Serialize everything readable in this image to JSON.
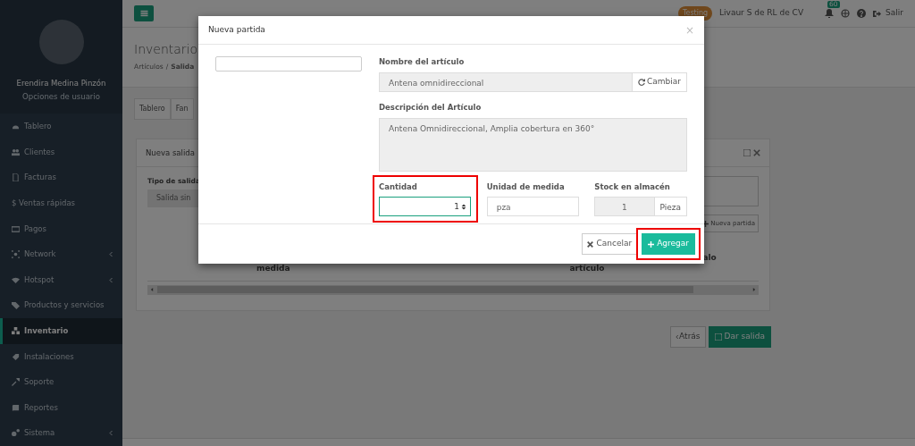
{
  "sidebar": {
    "user_name": "Erendira Medina Pinzón",
    "user_options": "Opciones de usuario",
    "items": [
      {
        "label": "Tablero",
        "selected": false,
        "has_submenu": false
      },
      {
        "label": "Clientes",
        "selected": false,
        "has_submenu": false
      },
      {
        "label": "Facturas",
        "selected": false,
        "has_submenu": false
      },
      {
        "label": "$ Ventas rápidas",
        "selected": false,
        "has_submenu": false
      },
      {
        "label": "Pagos",
        "selected": false,
        "has_submenu": false
      },
      {
        "label": "Network",
        "selected": false,
        "has_submenu": true
      },
      {
        "label": "Hotspot",
        "selected": false,
        "has_submenu": true
      },
      {
        "label": "Productos y servicios",
        "selected": false,
        "has_submenu": false
      },
      {
        "label": "Inventario",
        "selected": true,
        "has_submenu": false
      },
      {
        "label": "Instalaciones",
        "selected": false,
        "has_submenu": false
      },
      {
        "label": "Soporte",
        "selected": false,
        "has_submenu": false
      },
      {
        "label": "Reportes",
        "selected": false,
        "has_submenu": false
      },
      {
        "label": "Sistema",
        "selected": false,
        "has_submenu": true
      }
    ]
  },
  "topbar": {
    "env_badge": "Testing",
    "company": "Livaur S de RL de CV",
    "notifications": "60",
    "logout": "Salir"
  },
  "page": {
    "title": "Inventario",
    "breadcrumb": [
      "Artículos",
      "Salida"
    ],
    "breadcrumb_separator": "/",
    "tabs": [
      "Tablero",
      "Fan"
    ],
    "card": {
      "title": "Nueva salida",
      "type_label": "Tipo de salida",
      "type_value": "Salida sin",
      "new_item_button": "Nueva partida",
      "columns": [
        "medida",
        "artículo",
        "alo"
      ]
    },
    "back_button": "Atrás",
    "submit_button": "Dar salida"
  },
  "modal": {
    "title": "Nueva partida",
    "close": "×",
    "name_label": "Nombre del artículo",
    "name_value": "Antena omnidireccional",
    "change_button": "Cambiar",
    "description_label": "Descripción del Artículo",
    "description_value": "Antena Omnidireccional, Amplia cobertura en 360°",
    "quantity": {
      "label": "Cantidad",
      "value": "1",
      "focused": true,
      "highlighted": true
    },
    "unit": {
      "label": "Unidad de medida",
      "value": "pza"
    },
    "stock": {
      "label": "Stock en almacén",
      "value": "1",
      "unit": "Pieza"
    },
    "buttons": [
      {
        "kind": "cancel",
        "label": "Cancelar",
        "highlighted": false
      },
      {
        "kind": "add",
        "label": "Agregar",
        "highlighted": true
      }
    ]
  }
}
